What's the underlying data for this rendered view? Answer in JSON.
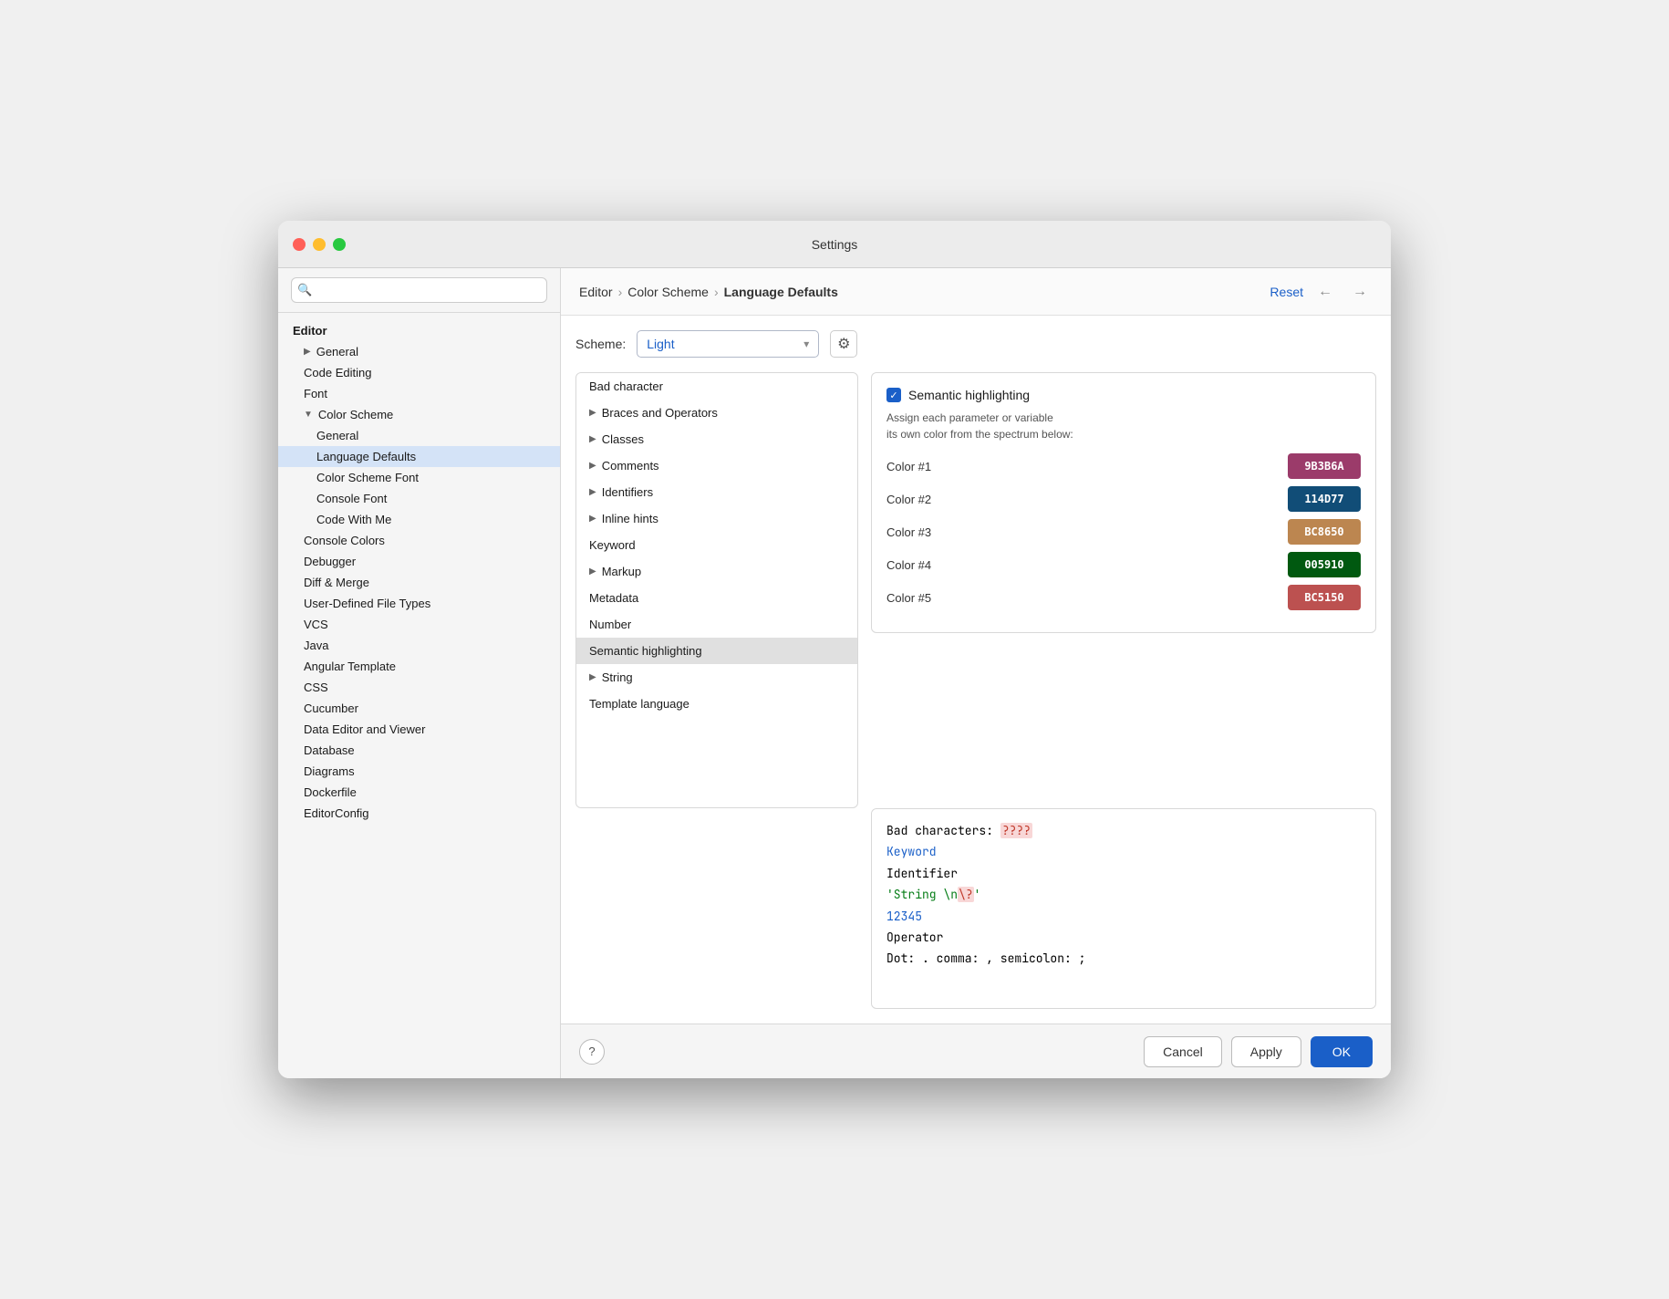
{
  "window": {
    "title": "Settings"
  },
  "breadcrumb": {
    "part1": "Editor",
    "part2": "Color Scheme",
    "part3": "Language Defaults"
  },
  "toolbar": {
    "reset_label": "Reset"
  },
  "scheme": {
    "label": "Scheme:",
    "value": "Light"
  },
  "sidebar": {
    "section_label": "Editor",
    "items": [
      {
        "label": "General",
        "indent": 1,
        "has_chevron": true,
        "active": false
      },
      {
        "label": "Code Editing",
        "indent": 1,
        "has_chevron": false,
        "active": false
      },
      {
        "label": "Font",
        "indent": 1,
        "has_chevron": false,
        "active": false
      },
      {
        "label": "Color Scheme",
        "indent": 1,
        "has_chevron": true,
        "expanded": true,
        "active": false
      },
      {
        "label": "General",
        "indent": 2,
        "has_chevron": false,
        "active": false
      },
      {
        "label": "Language Defaults",
        "indent": 2,
        "has_chevron": false,
        "active": true
      },
      {
        "label": "Color Scheme Font",
        "indent": 2,
        "has_chevron": false,
        "active": false
      },
      {
        "label": "Console Font",
        "indent": 2,
        "has_chevron": false,
        "active": false
      },
      {
        "label": "Code With Me",
        "indent": 2,
        "has_chevron": false,
        "active": false
      },
      {
        "label": "Console Colors",
        "indent": 1,
        "has_chevron": false,
        "active": false
      },
      {
        "label": "Debugger",
        "indent": 1,
        "has_chevron": false,
        "active": false
      },
      {
        "label": "Diff & Merge",
        "indent": 1,
        "has_chevron": false,
        "active": false
      },
      {
        "label": "User-Defined File Types",
        "indent": 1,
        "has_chevron": false,
        "active": false
      },
      {
        "label": "VCS",
        "indent": 1,
        "has_chevron": false,
        "active": false
      },
      {
        "label": "Java",
        "indent": 1,
        "has_chevron": false,
        "active": false
      },
      {
        "label": "Angular Template",
        "indent": 1,
        "has_chevron": false,
        "active": false
      },
      {
        "label": "CSS",
        "indent": 1,
        "has_chevron": false,
        "active": false
      },
      {
        "label": "Cucumber",
        "indent": 1,
        "has_chevron": false,
        "active": false
      },
      {
        "label": "Data Editor and Viewer",
        "indent": 1,
        "has_chevron": false,
        "active": false
      },
      {
        "label": "Database",
        "indent": 1,
        "has_chevron": false,
        "active": false
      },
      {
        "label": "Diagrams",
        "indent": 1,
        "has_chevron": false,
        "active": false
      },
      {
        "label": "Dockerfile",
        "indent": 1,
        "has_chevron": false,
        "active": false
      },
      {
        "label": "EditorConfig",
        "indent": 1,
        "has_chevron": false,
        "active": false
      }
    ]
  },
  "categories": [
    {
      "label": "Bad character",
      "has_chevron": false,
      "active": false
    },
    {
      "label": "Braces and Operators",
      "has_chevron": true,
      "active": false
    },
    {
      "label": "Classes",
      "has_chevron": true,
      "active": false
    },
    {
      "label": "Comments",
      "has_chevron": true,
      "active": false
    },
    {
      "label": "Identifiers",
      "has_chevron": true,
      "active": false
    },
    {
      "label": "Inline hints",
      "has_chevron": true,
      "active": false
    },
    {
      "label": "Keyword",
      "has_chevron": false,
      "active": false
    },
    {
      "label": "Markup",
      "has_chevron": true,
      "active": false
    },
    {
      "label": "Metadata",
      "has_chevron": false,
      "active": false
    },
    {
      "label": "Number",
      "has_chevron": false,
      "active": false
    },
    {
      "label": "Semantic highlighting",
      "has_chevron": false,
      "active": true
    },
    {
      "label": "String",
      "has_chevron": true,
      "active": false
    },
    {
      "label": "Template language",
      "has_chevron": false,
      "active": false
    }
  ],
  "semantic": {
    "checkbox_checked": true,
    "title": "Semantic highlighting",
    "description": "Assign each parameter or variable\nits own color from the spectrum below:",
    "colors": [
      {
        "label": "Color #1",
        "hex": "9B3B6A",
        "bg": "#9B3B6A"
      },
      {
        "label": "Color #2",
        "hex": "114D77",
        "bg": "#114D77"
      },
      {
        "label": "Color #3",
        "hex": "BC8650",
        "bg": "#BC8650"
      },
      {
        "label": "Color #4",
        "hex": "005910",
        "bg": "#005910"
      },
      {
        "label": "Color #5",
        "hex": "BC5150",
        "bg": "#BC5150"
      }
    ]
  },
  "preview": {
    "lines": [
      {
        "type": "bad_char",
        "prefix": "Bad characters: ",
        "bad": "????"
      },
      {
        "type": "keyword",
        "text": "Keyword"
      },
      {
        "type": "plain",
        "text": "Identifier"
      },
      {
        "type": "string",
        "text": "'String \\n\\?'"
      },
      {
        "type": "number",
        "text": "12345"
      },
      {
        "type": "plain",
        "text": "Operator"
      },
      {
        "type": "plain",
        "text": "Dot: . comma: , semicolon: ;"
      }
    ]
  },
  "buttons": {
    "cancel": "Cancel",
    "apply": "Apply",
    "ok": "OK"
  }
}
